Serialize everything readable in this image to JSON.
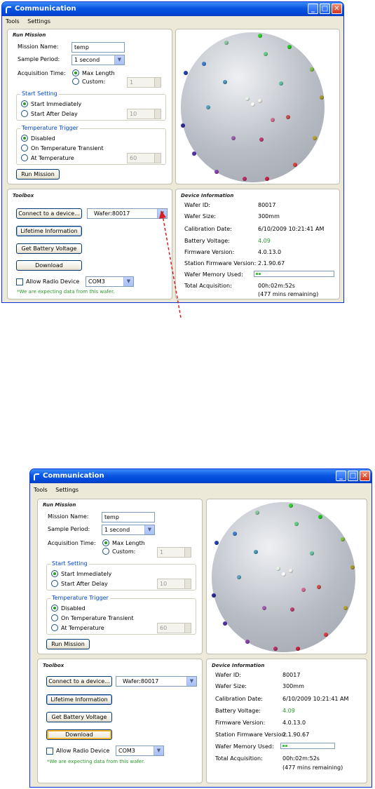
{
  "windows": [
    {
      "title": "Communication",
      "menu": [
        "Tools",
        "Settings"
      ],
      "run_mission": {
        "header": "Run Mission",
        "mission_name_label": "Mission Name:",
        "mission_name_value": "temp",
        "sample_period_label": "Sample Period:",
        "sample_period_value": "1 second",
        "acquisition_time_label": "Acquisition Time:",
        "max_length_label": "Max Length",
        "custom_label": "Custom:",
        "custom_value": "1",
        "start_setting": {
          "label": "Start Setting",
          "immediately": "Start Immediately",
          "after_delay": "Start After Delay",
          "delay_value": "10"
        },
        "temperature_trigger": {
          "label": "Temperature Trigger",
          "disabled": "Disabled",
          "transient": "On Temperature Transient",
          "at_temperature": "At Temperature",
          "temp_value": "60"
        },
        "run_button": "Run Mission"
      },
      "toolbox": {
        "header": "Toolbox",
        "connect_button": "Connect to a device...",
        "device_value": "Wafer:80017",
        "lifetime_button": "Lifetime Information",
        "battery_button": "Get Battery Voltage",
        "download_button": "Download",
        "allow_radio_label": "Allow Radio Device",
        "com_value": "COM3",
        "status_text": "*We are expecting data from this wafer."
      },
      "device_info": {
        "header": "Device Information",
        "rows": [
          {
            "label": "Wafer ID:",
            "value": "80017"
          },
          {
            "label": "Wafer Size:",
            "value": "300mm"
          },
          {
            "label": "Calibration Date:",
            "value": "6/10/2009 10:21:41 AM"
          },
          {
            "label": "Battery Voltage:",
            "value": "4.09"
          },
          {
            "label": "Firmware Version:",
            "value": "4.0.13.0"
          },
          {
            "label": "Station Firmware Version:",
            "value": "2.1.90.67"
          },
          {
            "label": "Wafer Memory Used:",
            "value": ""
          },
          {
            "label": "Total Acquisition:",
            "value": "00h:02m:52s"
          }
        ],
        "remaining": "(477 mins remaining)",
        "memory_used_fraction": 0.05
      }
    },
    {
      "title": "Communication",
      "menu": [
        "Tools",
        "Settings"
      ],
      "run_mission": {
        "header": "Run Mission",
        "mission_name_label": "Mission Name:",
        "mission_name_value": "temp",
        "sample_period_label": "Sample Period:",
        "sample_period_value": "1 second",
        "acquisition_time_label": "Acquisition Time:",
        "max_length_label": "Max Length",
        "custom_label": "Custom:",
        "custom_value": "1",
        "start_setting": {
          "label": "Start Setting",
          "immediately": "Start Immediately",
          "after_delay": "Start After Delay",
          "delay_value": "10"
        },
        "temperature_trigger": {
          "label": "Temperature Trigger",
          "disabled": "Disabled",
          "transient": "On Temperature Transient",
          "at_temperature": "At Temperature",
          "temp_value": "60"
        },
        "run_button": "Run Mission"
      },
      "toolbox": {
        "header": "Toolbox",
        "connect_button": "Connect to a device...",
        "device_value": "Wafer:80017",
        "lifetime_button": "Lifetime Information",
        "battery_button": "Get Battery Voltage",
        "download_button": "Download",
        "allow_radio_label": "Allow Radio Device",
        "com_value": "COM3",
        "status_text": "*We are expecting data from this wafer."
      },
      "device_info": {
        "header": "Device Information",
        "rows": [
          {
            "label": "Wafer ID:",
            "value": "80017"
          },
          {
            "label": "Wafer Size:",
            "value": "300mm"
          },
          {
            "label": "Calibration Date:",
            "value": "6/10/2009 10:21:41 AM"
          },
          {
            "label": "Battery Voltage:",
            "value": "4.09"
          },
          {
            "label": "Firmware Version:",
            "value": "4.0.13.0"
          },
          {
            "label": "Station Firmware Version:",
            "value": "2.1.90.67"
          },
          {
            "label": "Wafer Memory Used:",
            "value": ""
          },
          {
            "label": "Total Acquisition:",
            "value": "00h:02m:52s"
          }
        ],
        "remaining": "(477 mins remaining)",
        "memory_used_fraction": 0.05
      }
    }
  ],
  "colors": {
    "battery_voltage": "#2a9a2a",
    "status_text": "#2a9a2a",
    "group_label": "#0046d5",
    "annotation_arrow": "#d81e1e"
  }
}
